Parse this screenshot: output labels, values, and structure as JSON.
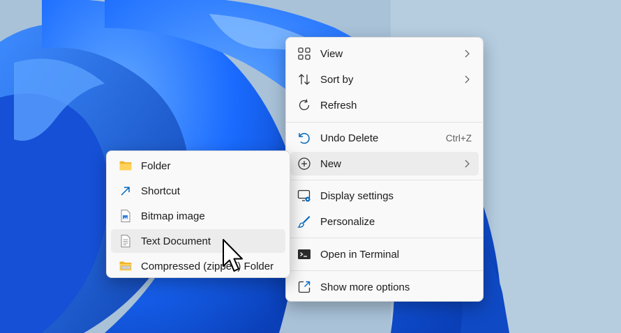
{
  "colors": {
    "desktop_bg": "#a9c2d8",
    "bloom_dark": "#0a3fb7",
    "bloom_mid": "#1a6bff",
    "bloom_light": "#62a8ff",
    "menu_bg": "#f9f9f9",
    "hover_bg": "#ececec",
    "accent": "#0067c0"
  },
  "context_menu": {
    "items": [
      {
        "label": "View",
        "icon": "grid-icon",
        "submenu": true
      },
      {
        "label": "Sort by",
        "icon": "sort-icon",
        "submenu": true
      },
      {
        "label": "Refresh",
        "icon": "refresh-icon"
      },
      {
        "label": "Undo Delete",
        "icon": "undo-icon",
        "shortcut": "Ctrl+Z"
      },
      {
        "label": "New",
        "icon": "plus-circle-icon",
        "submenu": true,
        "highlighted": true
      },
      {
        "label": "Display settings",
        "icon": "display-settings-icon"
      },
      {
        "label": "Personalize",
        "icon": "brush-icon"
      },
      {
        "label": "Open in Terminal",
        "icon": "terminal-icon"
      },
      {
        "label": "Show more options",
        "icon": "open-external-icon"
      }
    ]
  },
  "new_submenu": {
    "items": [
      {
        "label": "Folder",
        "icon": "folder-icon"
      },
      {
        "label": "Shortcut",
        "icon": "shortcut-icon"
      },
      {
        "label": "Bitmap image",
        "icon": "bitmap-icon"
      },
      {
        "label": "Text Document",
        "icon": "text-document-icon",
        "highlighted": true
      },
      {
        "label": "Compressed (zipped) Folder",
        "icon": "zip-folder-icon"
      }
    ]
  }
}
